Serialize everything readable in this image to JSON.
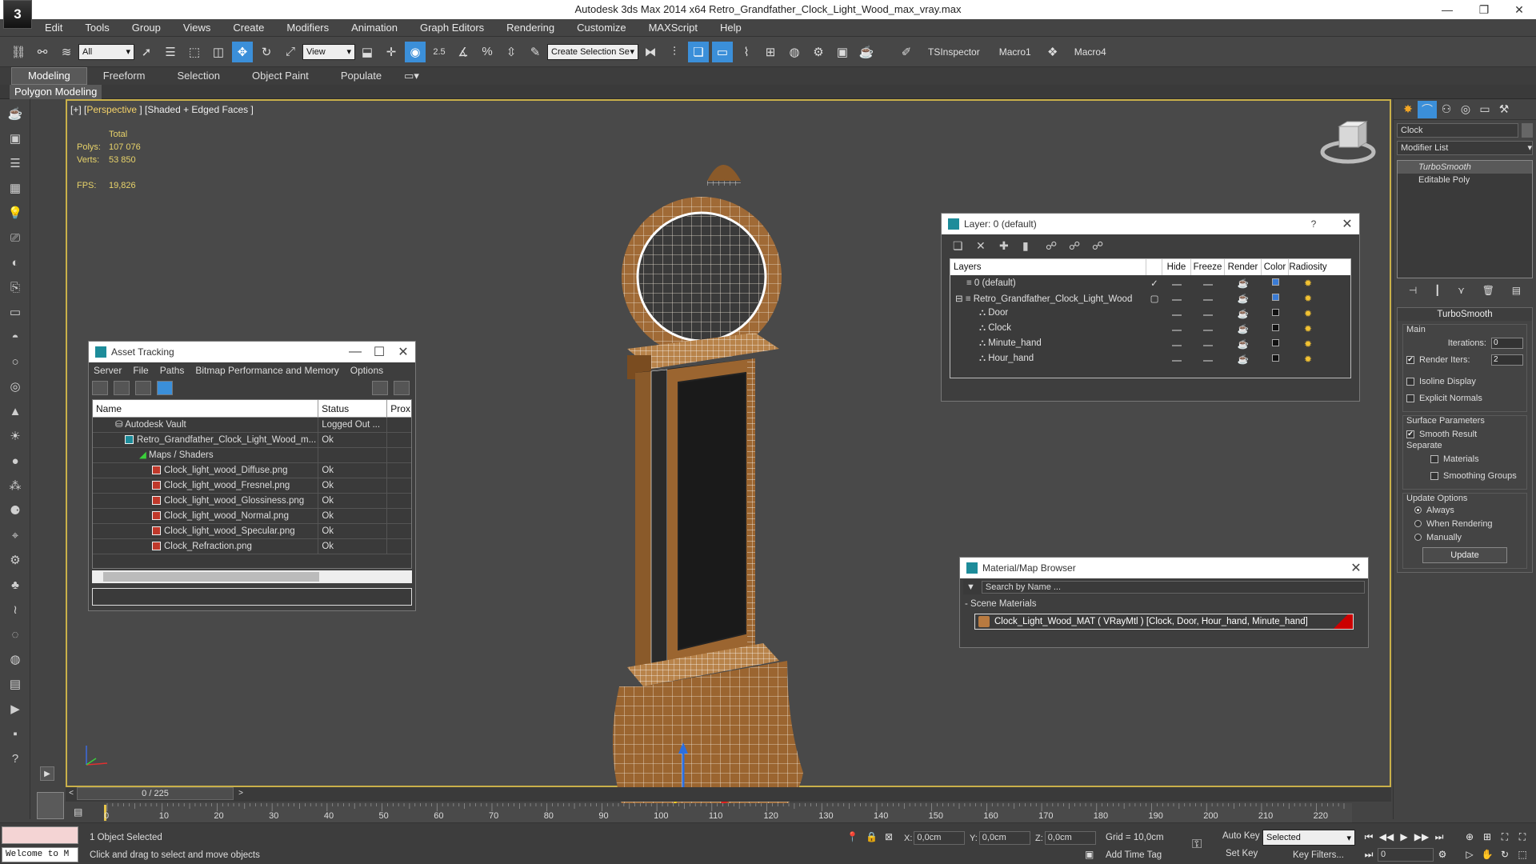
{
  "app": {
    "title": "Autodesk 3ds Max  2014 x64     Retro_Grandfather_Clock_Light_Wood_max_vray.max",
    "logo": "3"
  },
  "window_controls": [
    "—",
    "❐",
    "✕"
  ],
  "menu": [
    "Edit",
    "Tools",
    "Group",
    "Views",
    "Create",
    "Modifiers",
    "Animation",
    "Graph Editors",
    "Rendering",
    "Customize",
    "MAXScript",
    "Help"
  ],
  "toolbar": {
    "selection_filter": "All",
    "ref_coord": "View",
    "named_selection": "Create Selection Se",
    "snap_label": "2.5",
    "macros": [
      "TSInspector",
      "Macro1",
      "Macro4"
    ]
  },
  "ribbon": {
    "tabs": [
      "Modeling",
      "Freeform",
      "Selection",
      "Object Paint",
      "Populate"
    ],
    "active": "Modeling",
    "subpanel": "Polygon Modeling"
  },
  "viewport": {
    "label_prefix": "[+] [",
    "label_view": "Perspective",
    "label_suffix": " ] [Shaded + Edged Faces ]",
    "stats_title": "Total",
    "polys_label": "Polys:",
    "polys": "107 076",
    "verts_label": "Verts:",
    "verts": "53 850",
    "fps_label": "FPS:",
    "fps": "19,826",
    "viewcube_text": "FRONT"
  },
  "asset_tracking": {
    "title": "Asset Tracking",
    "menu": [
      "Server",
      "File",
      "Paths",
      "Bitmap Performance and Memory",
      "Options"
    ],
    "columns": [
      "Name",
      "Status",
      "Prox"
    ],
    "rows": [
      {
        "name": "Autodesk Vault",
        "status": "Logged Out ..."
      },
      {
        "name": "Retro_Grandfather_Clock_Light_Wood_m...",
        "status": "Ok"
      },
      {
        "name": "Maps / Shaders",
        "status": ""
      },
      {
        "name": "Clock_light_wood_Diffuse.png",
        "status": "Ok"
      },
      {
        "name": "Clock_light_wood_Fresnel.png",
        "status": "Ok"
      },
      {
        "name": "Clock_light_wood_Glossiness.png",
        "status": "Ok"
      },
      {
        "name": "Clock_light_wood_Normal.png",
        "status": "Ok"
      },
      {
        "name": "Clock_light_wood_Specular.png",
        "status": "Ok"
      },
      {
        "name": "Clock_Refraction.png",
        "status": "Ok"
      }
    ]
  },
  "layer_panel": {
    "title": "Layer: 0 (default)",
    "help": "?",
    "columns": [
      "Layers",
      "Hide",
      "Freeze",
      "Render",
      "Color",
      "Radiosity"
    ],
    "rows": [
      {
        "name": "0 (default)",
        "color": "#3a7bd5"
      },
      {
        "name": "Retro_Grandfather_Clock_Light_Wood",
        "color": "#3a7bd5"
      },
      {
        "name": "Door",
        "color": "#111111"
      },
      {
        "name": "Clock",
        "color": "#111111"
      },
      {
        "name": "Minute_hand",
        "color": "#111111"
      },
      {
        "name": "Hour_hand",
        "color": "#111111"
      }
    ]
  },
  "material_browser": {
    "title": "Material/Map Browser",
    "search_placeholder": "Search by Name ...",
    "group": "- Scene Materials",
    "item": "Clock_Light_Wood_MAT  ( VRayMtl ) [Clock, Door, Hour_hand, Minute_hand]"
  },
  "command_panel": {
    "object_name": "Clock",
    "modifier_list": "Modifier List",
    "stack": [
      "TurboSmooth",
      "Editable Poly"
    ],
    "turbosmooth": {
      "title": "TurboSmooth",
      "main": "Main",
      "iterations_label": "Iterations:",
      "iterations": "0",
      "render_iters_label": "Render Iters:",
      "render_iters": "2",
      "isoline": "Isoline Display",
      "explicit": "Explicit Normals",
      "surface": "Surface Parameters",
      "smooth_result": "Smooth Result",
      "separate": "Separate",
      "materials": "Materials",
      "smoothing_groups": "Smoothing Groups",
      "update_options": "Update Options",
      "always": "Always",
      "when_rendering": "When Rendering",
      "manually": "Manually",
      "update": "Update"
    }
  },
  "timeline": {
    "frame": "0 / 225",
    "ticks": [
      "0",
      "10",
      "20",
      "30",
      "40",
      "50",
      "60",
      "70",
      "80",
      "90",
      "100",
      "110",
      "120",
      "130",
      "140",
      "150",
      "160",
      "170",
      "180",
      "190",
      "200",
      "210",
      "220"
    ]
  },
  "status": {
    "selected": "1 Object Selected",
    "prompt": "Click and drag to select and move objects",
    "x_label": "X:",
    "x": "0,0cm",
    "y_label": "Y:",
    "y": "0,0cm",
    "z_label": "Z:",
    "z": "0,0cm",
    "grid": "Grid = 10,0cm",
    "add_time_tag": "Add Time Tag",
    "auto_key": "Auto Key",
    "set_key": "Set Key",
    "selected_dropdown": "Selected",
    "key_filters": "Key Filters...",
    "frame_field": "0",
    "welcome": "Welcome to M"
  },
  "colors": {
    "accent": "#3b8fd9",
    "viewport_border": "#c9b04a",
    "stats_text": "#e8d36a"
  }
}
